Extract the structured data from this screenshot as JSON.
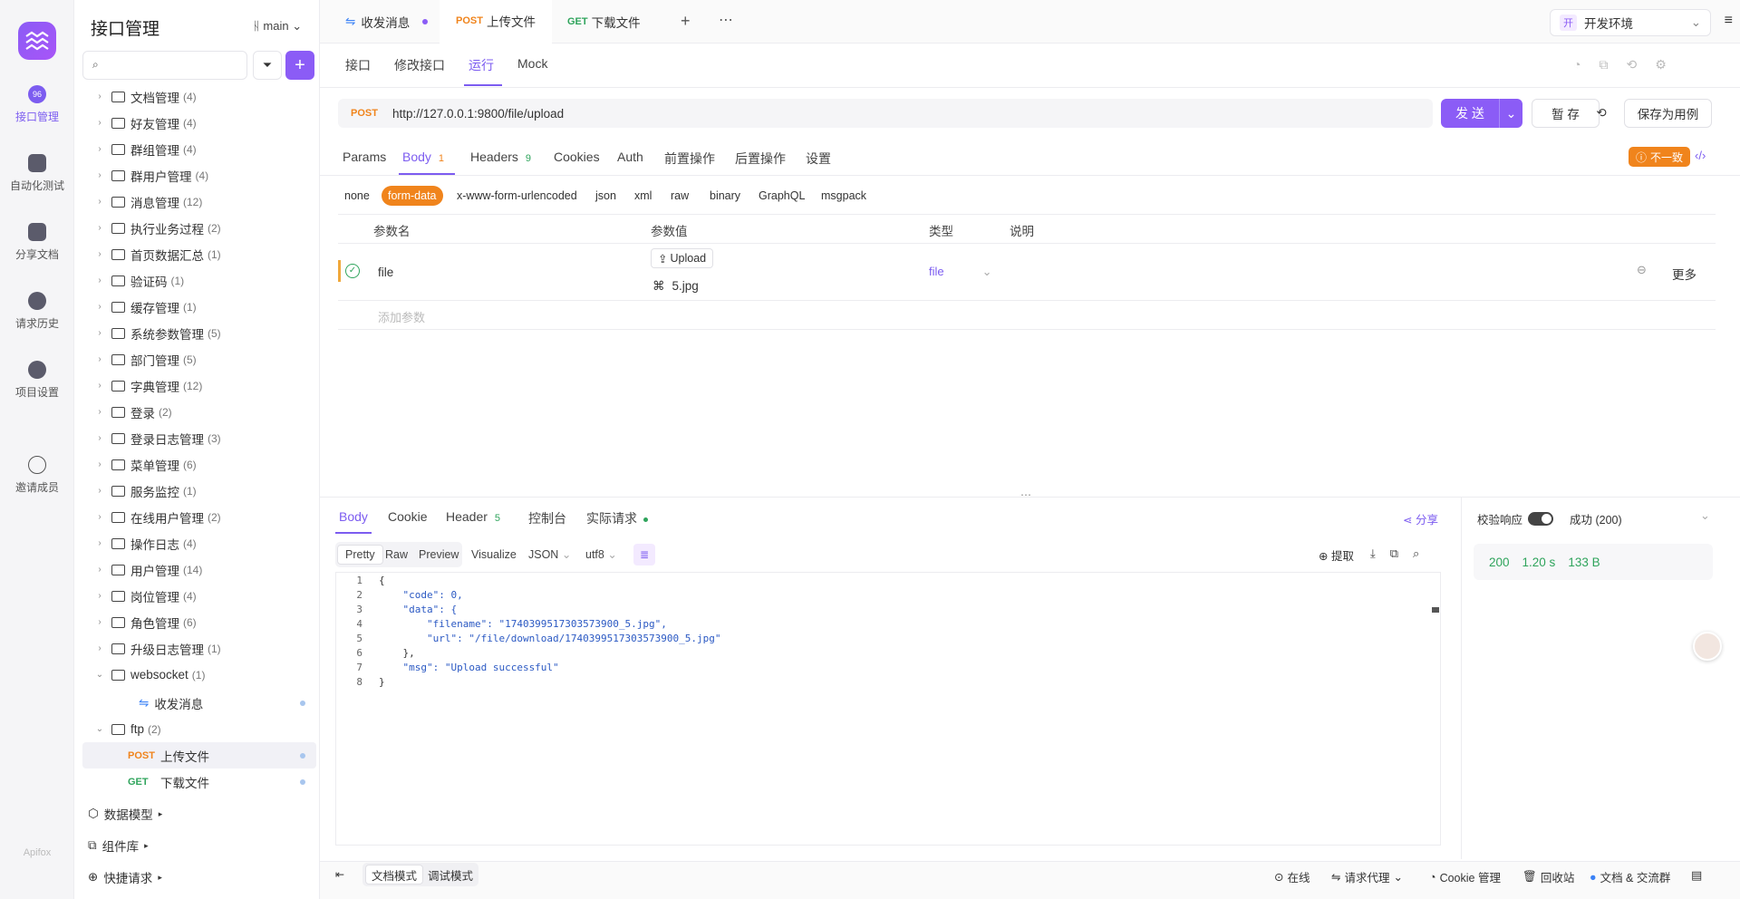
{
  "rail": {
    "items": [
      {
        "label": "接口管理",
        "badge": "96"
      },
      {
        "label": "自动化测试"
      },
      {
        "label": "分享文档"
      },
      {
        "label": "请求历史"
      },
      {
        "label": "项目设置"
      },
      {
        "label": "邀请成员"
      }
    ],
    "bottom_logo": "Apifox"
  },
  "tree": {
    "title": "接口管理",
    "branch": "main",
    "items": [
      {
        "name": "文档管理",
        "count": "(4)"
      },
      {
        "name": "好友管理",
        "count": "(4)"
      },
      {
        "name": "群组管理",
        "count": "(4)"
      },
      {
        "name": "群用户管理",
        "count": "(4)"
      },
      {
        "name": "消息管理",
        "count": "(12)"
      },
      {
        "name": "执行业务过程",
        "count": "(2)"
      },
      {
        "name": "首页数据汇总",
        "count": "(1)"
      },
      {
        "name": "验证码",
        "count": "(1)"
      },
      {
        "name": "缓存管理",
        "count": "(1)"
      },
      {
        "name": "系统参数管理",
        "count": "(5)"
      },
      {
        "name": "部门管理",
        "count": "(5)"
      },
      {
        "name": "字典管理",
        "count": "(12)"
      },
      {
        "name": "登录",
        "count": "(2)"
      },
      {
        "name": "登录日志管理",
        "count": "(3)"
      },
      {
        "name": "菜单管理",
        "count": "(6)"
      },
      {
        "name": "服务监控",
        "count": "(1)"
      },
      {
        "name": "在线用户管理",
        "count": "(2)"
      },
      {
        "name": "操作日志",
        "count": "(4)"
      },
      {
        "name": "用户管理",
        "count": "(14)"
      },
      {
        "name": "岗位管理",
        "count": "(4)"
      },
      {
        "name": "角色管理",
        "count": "(6)"
      },
      {
        "name": "升级日志管理",
        "count": "(1)"
      },
      {
        "name": "websocket",
        "count": "(1)"
      }
    ],
    "ws_child": "收发消息",
    "ftp": {
      "name": "ftp",
      "count": "(2)"
    },
    "ftp_children": [
      {
        "method": "POST",
        "name": "上传文件"
      },
      {
        "method": "GET",
        "name": "下载文件"
      }
    ],
    "footer": [
      "数据模型",
      "组件库",
      "快捷请求"
    ]
  },
  "tabs": {
    "open": [
      {
        "method": "",
        "label": "收发消息"
      },
      {
        "method": "POST",
        "label": "上传文件"
      },
      {
        "method": "GET",
        "label": "下载文件"
      }
    ],
    "env": "开发环境",
    "env_badge": "开"
  },
  "subtabs": [
    "接口",
    "修改接口",
    "运行",
    "Mock"
  ],
  "request": {
    "method": "POST",
    "url": "http://127.0.0.1:9800/file/upload",
    "send": "发 送",
    "save_temp": "暂 存",
    "save_case": "保存为用例"
  },
  "param_tabs": [
    {
      "label": "Params",
      "count": ""
    },
    {
      "label": "Body",
      "count": "1"
    },
    {
      "label": "Headers",
      "count": "9"
    },
    {
      "label": "Cookies",
      "count": ""
    },
    {
      "label": "Auth",
      "count": ""
    },
    {
      "label": "前置操作",
      "count": ""
    },
    {
      "label": "后置操作",
      "count": ""
    },
    {
      "label": "设置",
      "count": ""
    }
  ],
  "inconsistent": "不一致",
  "body_types": [
    "none",
    "form-data",
    "x-www-form-urlencoded",
    "json",
    "xml",
    "raw",
    "binary",
    "GraphQL",
    "msgpack"
  ],
  "table": {
    "headers": [
      "参数名",
      "参数值",
      "类型",
      "说明"
    ],
    "row": {
      "name": "file",
      "upload": "Upload",
      "file": "5.jpg",
      "type": "file",
      "more": "更多"
    },
    "add_placeholder": "添加参数"
  },
  "response": {
    "tabs": [
      {
        "label": "Body",
        "count": ""
      },
      {
        "label": "Cookie",
        "count": ""
      },
      {
        "label": "Header",
        "count": "5"
      },
      {
        "label": "控制台",
        "count": ""
      },
      {
        "label": "实际请求",
        "count": ""
      }
    ],
    "share": "分享",
    "formats": [
      "Pretty",
      "Raw",
      "Preview",
      "Visualize"
    ],
    "lang": "JSON",
    "encoding": "utf8",
    "extract": "提取",
    "code_lines": [
      "{",
      "    \"code\": 0,",
      "    \"data\": {",
      "        \"filename\": \"1740399517303573900_5.jpg\",",
      "        \"url\": \"/file/download/1740399517303573900_5.jpg\"",
      "    },",
      "    \"msg\": \"Upload successful\"",
      "}"
    ],
    "validate_label": "校验响应",
    "validate_status": "成功 (200)",
    "status": "200",
    "time": "1.20 s",
    "size": "133 B"
  },
  "statusbar": {
    "modes": [
      "文档模式",
      "调试模式"
    ],
    "online": "在线",
    "proxy": "请求代理",
    "cookie": "Cookie 管理",
    "recycle": "回收站",
    "community": "文档 & 交流群"
  }
}
